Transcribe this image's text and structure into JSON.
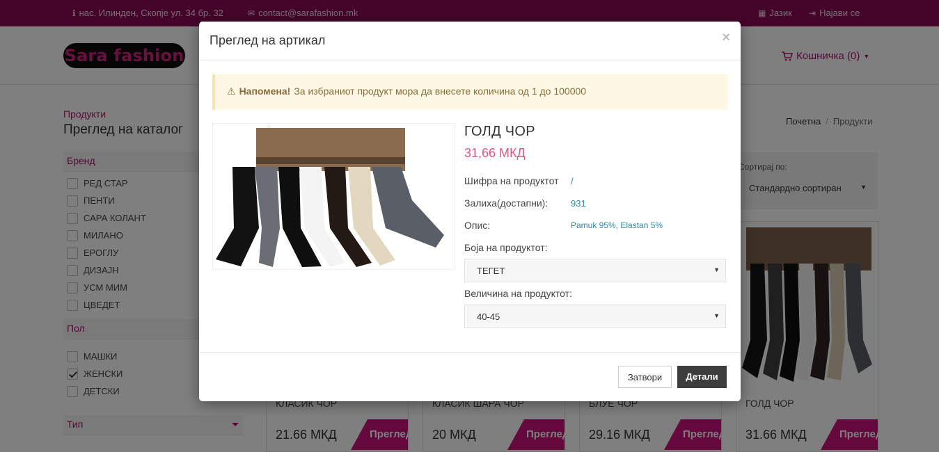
{
  "topbar": {
    "address": "нас. Илинден, Скопје ул. 34 бр. 32",
    "email": "contact@sarafashion.mk",
    "language": "Јазик",
    "login": "Најави се"
  },
  "header": {
    "logo_text": "Sara fashion",
    "cart_label": "Кошничка (0)"
  },
  "page": {
    "section_small": "Продукти",
    "section_title": "Преглед на каталог",
    "breadcrumb": {
      "home": "Почетна",
      "sep": "/",
      "current": "Продукти"
    }
  },
  "sidebar": {
    "brand": {
      "title": "Бренд",
      "items": [
        "РЕД СТАР",
        "ПЕНТИ",
        "САРА КОЛАНТ",
        "МИЛАНО",
        "ЕРОГЛУ",
        "ДИЗАЈН",
        "УСМ МИМ",
        "ЦВЕДЕТ"
      ]
    },
    "gender": {
      "title": "Пол",
      "items": [
        "МАШКИ",
        "ЖЕНСКИ",
        "ДЕТСКИ"
      ],
      "checked": "ЖЕНСКИ"
    },
    "type": {
      "title": "Тип"
    }
  },
  "sort": {
    "label": "Сортирај по:",
    "value": "Стандардно сортиран"
  },
  "products": [
    {
      "name": "КЛАСИК ЧОР",
      "price": "21.66 МКД",
      "view": "Преглед"
    },
    {
      "name": "КЛАСИК ШАРА ЧОР",
      "price": "20 МКД",
      "view": "Преглед"
    },
    {
      "name": "БЛУЕ ЧОР",
      "price": "29.16 МКД",
      "view": "Преглед"
    },
    {
      "name": "ГОЛД ЧОР",
      "price": "31.66 МКД",
      "view": "Преглед"
    }
  ],
  "modal": {
    "title": "Преглед на артикал",
    "close_symbol": "×",
    "alert_strong": "Напомена!",
    "alert_text": "За избраниот продукт мора да внесете количина од 1 до 100000",
    "product_name": "ГОЛД ЧОР",
    "product_price": "31,66 МКД",
    "code_label": "Шифра на продуктот",
    "code_value": "/",
    "stock_label": "Залиха(достапни):",
    "stock_value": "931",
    "desc_label": "Опис:",
    "desc_value": "Pamuk 95%, Elastan 5%",
    "color_label": "Боја на продуктот:",
    "color_value": "ТЕГЕТ",
    "size_label": "Величина на продуктот:",
    "size_value": "40-45",
    "btn_close": "Затвори",
    "btn_details": "Детали"
  },
  "colors": {
    "brand": "#8b0b55",
    "accent": "#c8117a",
    "price": "#e4577f",
    "link": "#2d8ab0"
  }
}
